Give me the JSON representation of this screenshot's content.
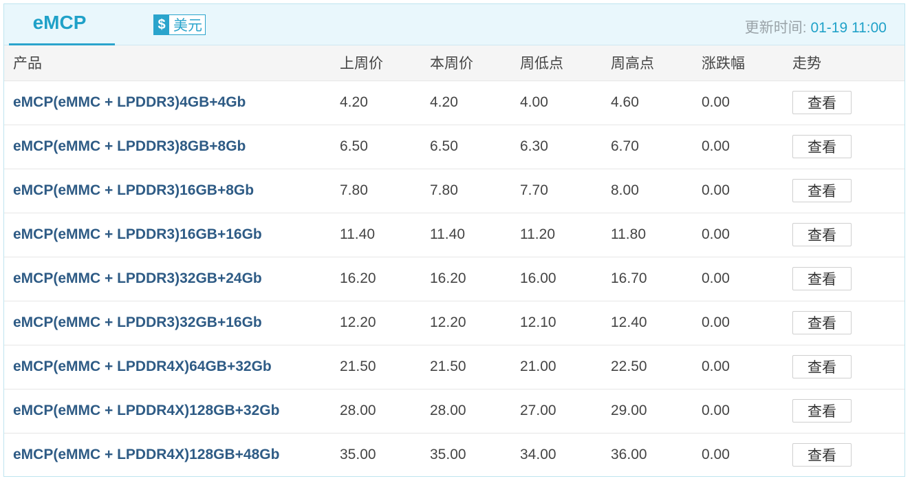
{
  "tab": {
    "label": "eMCP"
  },
  "currency": {
    "icon": "$",
    "label": "美元"
  },
  "updated": {
    "prefix": "更新时间: ",
    "time": "01-19 11:00"
  },
  "headers": [
    "产品",
    "上周价",
    "本周价",
    "周低点",
    "周高点",
    "涨跌幅",
    "走势"
  ],
  "rows": [
    {
      "product": "eMCP(eMMC + LPDDR3)4GB+4Gb",
      "last": "4.20",
      "this": "4.20",
      "low": "4.00",
      "high": "4.60",
      "change": "0.00",
      "action": "查看"
    },
    {
      "product": "eMCP(eMMC + LPDDR3)8GB+8Gb",
      "last": "6.50",
      "this": "6.50",
      "low": "6.30",
      "high": "6.70",
      "change": "0.00",
      "action": "查看"
    },
    {
      "product": "eMCP(eMMC + LPDDR3)16GB+8Gb",
      "last": "7.80",
      "this": "7.80",
      "low": "7.70",
      "high": "8.00",
      "change": "0.00",
      "action": "查看"
    },
    {
      "product": "eMCP(eMMC + LPDDR3)16GB+16Gb",
      "last": "11.40",
      "this": "11.40",
      "low": "11.20",
      "high": "11.80",
      "change": "0.00",
      "action": "查看"
    },
    {
      "product": "eMCP(eMMC + LPDDR3)32GB+24Gb",
      "last": "16.20",
      "this": "16.20",
      "low": "16.00",
      "high": "16.70",
      "change": "0.00",
      "action": "查看"
    },
    {
      "product": "eMCP(eMMC + LPDDR3)32GB+16Gb",
      "last": "12.20",
      "this": "12.20",
      "low": "12.10",
      "high": "12.40",
      "change": "0.00",
      "action": "查看"
    },
    {
      "product": "eMCP(eMMC + LPDDR4X)64GB+32Gb",
      "last": "21.50",
      "this": "21.50",
      "low": "21.00",
      "high": "22.50",
      "change": "0.00",
      "action": "查看"
    },
    {
      "product": "eMCP(eMMC + LPDDR4X)128GB+32Gb",
      "last": "28.00",
      "this": "28.00",
      "low": "27.00",
      "high": "29.00",
      "change": "0.00",
      "action": "查看"
    },
    {
      "product": "eMCP(eMMC + LPDDR4X)128GB+48Gb",
      "last": "35.00",
      "this": "35.00",
      "low": "34.00",
      "high": "36.00",
      "change": "0.00",
      "action": "查看"
    }
  ]
}
